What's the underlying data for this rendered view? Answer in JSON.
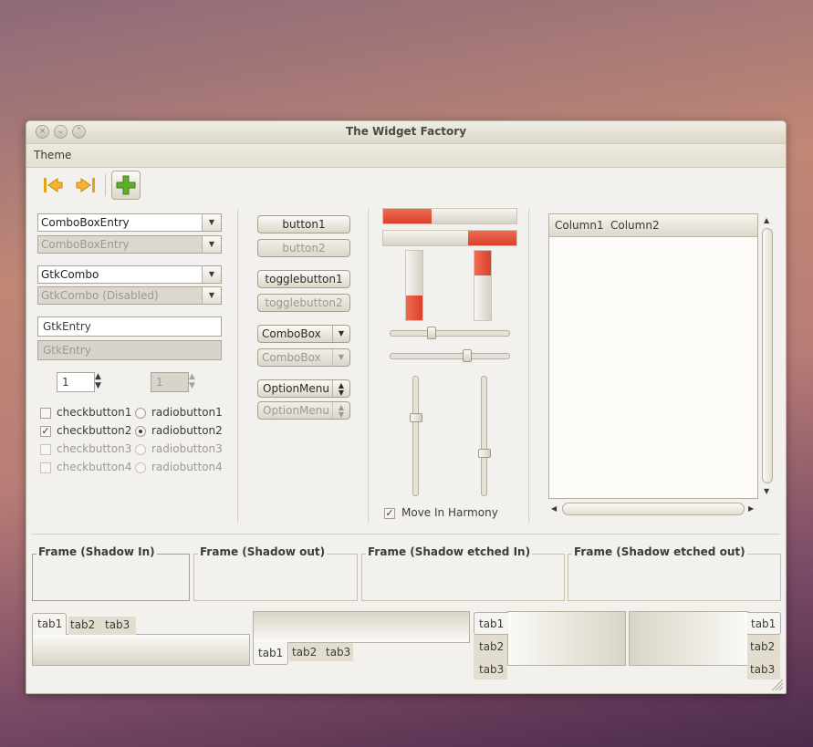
{
  "window": {
    "title": "The Widget Factory"
  },
  "menubar": {
    "theme": "Theme"
  },
  "toolbar": {
    "back_icon": "arrow-left-icon",
    "forward_icon": "arrow-right-icon",
    "add_icon": "plus-icon"
  },
  "left": {
    "combobox_entry": "ComboBoxEntry",
    "combobox_entry_disabled": "ComboBoxEntry",
    "gtk_combo": "GtkCombo",
    "gtk_combo_disabled": "GtkCombo (Disabled)",
    "gtk_entry": "GtkEntry",
    "gtk_entry_disabled": "GtkEntry",
    "spin_value": "1",
    "spin_disabled_value": "1",
    "checks": [
      {
        "label": "checkbutton1",
        "checked": false
      },
      {
        "label": "checkbutton2",
        "checked": true
      },
      {
        "label": "checkbutton3",
        "checked": false
      },
      {
        "label": "checkbutton4",
        "checked": false
      }
    ],
    "radios": [
      {
        "label": "radiobutton1",
        "checked": false
      },
      {
        "label": "radiobutton2",
        "checked": true
      },
      {
        "label": "radiobutton3",
        "checked": false
      },
      {
        "label": "radiobutton4",
        "checked": false
      }
    ],
    "check_mark": "✓"
  },
  "middle": {
    "button1": "button1",
    "button2": "button2",
    "toggle1": "togglebutton1",
    "toggle2": "togglebutton2",
    "combobox": "ComboBox",
    "combobox_disabled": "ComboBox",
    "optionmenu": "OptionMenu",
    "optionmenu_disabled": "OptionMenu"
  },
  "progress": {
    "h1_fraction": 0.36,
    "h2_fraction": 0.36,
    "v1_fraction": 0.36,
    "v2_fraction": 0.36,
    "hscale1_value": 0.35,
    "hscale2_value": 0.65,
    "vscale1_value": 0.35,
    "vscale2_value": 0.65,
    "harmony_label": "Move In Harmony",
    "harmony_checked": true,
    "accent_color": "#e9543f"
  },
  "tree": {
    "column1": "Column1",
    "column2": "Column2"
  },
  "frames": {
    "shadow_in": "Frame (Shadow In)",
    "shadow_out": "Frame (Shadow out)",
    "shadow_etched_in": "Frame (Shadow etched In)",
    "shadow_etched_out": "Frame (Shadow etched out)"
  },
  "notebooks": {
    "tabs": [
      "tab1",
      "tab2",
      "tab3"
    ]
  }
}
